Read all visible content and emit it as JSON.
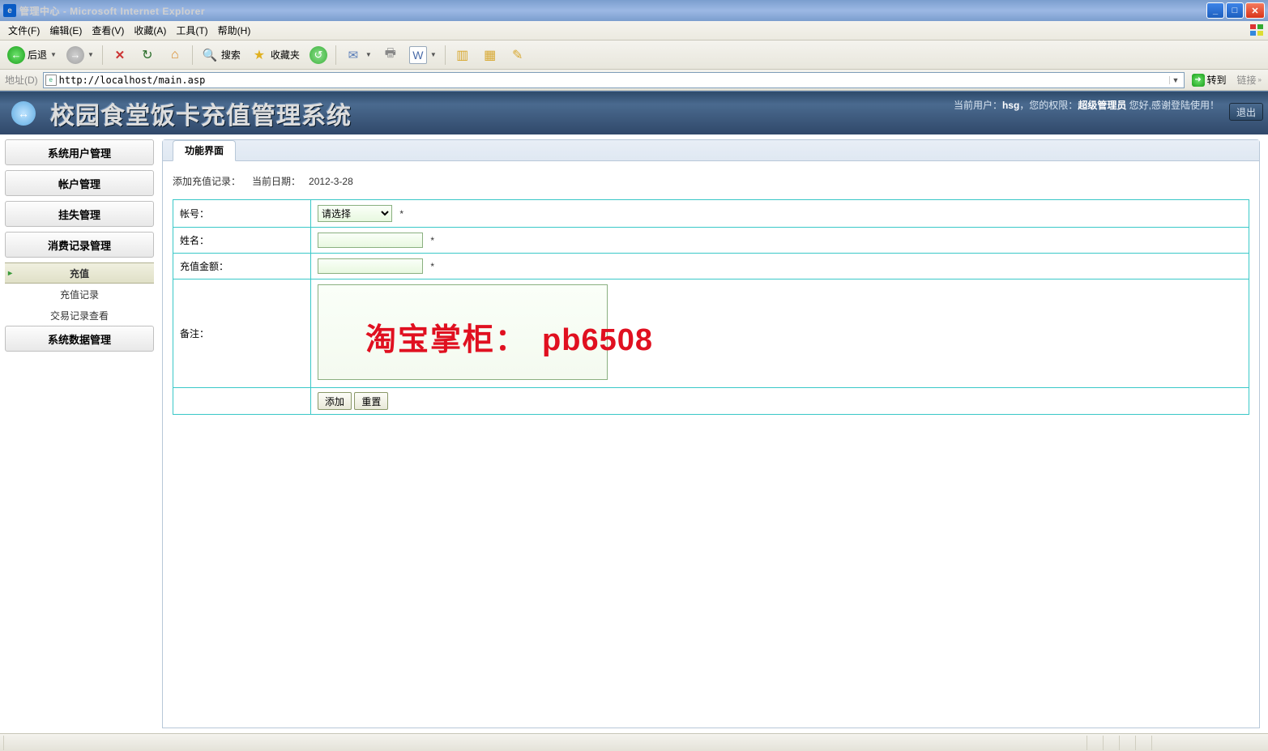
{
  "window": {
    "title": "管理中心 - Microsoft Internet Explorer",
    "min": "_",
    "max": "□",
    "close": "✕"
  },
  "menu": {
    "file": "文件(F)",
    "edit": "编辑(E)",
    "view": "查看(V)",
    "favorites": "收藏(A)",
    "tools": "工具(T)",
    "help": "帮助(H)"
  },
  "toolbar": {
    "back": "后退",
    "search": "搜索",
    "favorites": "收藏夹"
  },
  "address": {
    "label": "地址(D)",
    "url": "http://localhost/main.asp",
    "go": "转到",
    "links": "链接"
  },
  "app": {
    "title": "校园食堂饭卡充值管理系统",
    "user_prefix": "当前用户：",
    "user": "hsg",
    "role_prefix": "，您的权限：",
    "role": "超级管理员",
    "greeting": "  您好,感谢登陆使用！",
    "logout": "退出"
  },
  "sidebar": {
    "items": [
      {
        "label": "系统用户管理"
      },
      {
        "label": "帐户管理"
      },
      {
        "label": "挂失管理"
      },
      {
        "label": "消费记录管理"
      },
      {
        "label": "系统数据管理"
      }
    ],
    "subitems": {
      "recharge": "充值",
      "recharge_log": "充值记录",
      "tx_view": "交易记录查看"
    }
  },
  "main": {
    "tab": "功能界面",
    "form_title": "添加充值记录：",
    "date_label": "当前日期：",
    "date_value": "2012-3-28",
    "fields": {
      "account": "帐号：",
      "account_select": "请选择",
      "name": "姓名：",
      "amount": "充值金额：",
      "remark": "备注：",
      "required": "*"
    },
    "buttons": {
      "add": "添加",
      "reset": "重置"
    }
  },
  "watermark": {
    "part1": "淘宝掌柜：",
    "part2": "pb6508"
  }
}
